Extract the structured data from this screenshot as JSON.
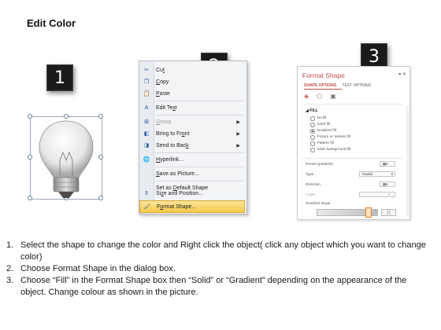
{
  "title": "Edit Color",
  "badges": [
    "1",
    "2",
    "3"
  ],
  "context_menu": {
    "items": [
      {
        "pre": "Cu",
        "u": "t",
        "post": "",
        "icon": "scissors-icon",
        "glyph": "✂"
      },
      {
        "pre": "",
        "u": "C",
        "post": "opy",
        "icon": "copy-icon",
        "glyph": "❐"
      },
      {
        "pre": "",
        "u": "P",
        "post": "aste",
        "icon": "paste-icon",
        "glyph": "📋"
      },
      {
        "pre": "Edit Te",
        "u": "x",
        "post": "t",
        "icon": "edit-text-icon",
        "glyph": "A"
      },
      {
        "pre": "",
        "u": "G",
        "post": "roup",
        "icon": "group-icon",
        "glyph": "⊞",
        "disabled": true,
        "submenu": true
      },
      {
        "pre": "Bring to Fr",
        "u": "o",
        "post": "nt",
        "icon": "bring-to-front-icon",
        "glyph": "◧",
        "submenu": true
      },
      {
        "pre": "Send to Bac",
        "u": "k",
        "post": "",
        "icon": "send-to-back-icon",
        "glyph": "◨",
        "submenu": true
      },
      {
        "pre": "",
        "u": "H",
        "post": "yperlink...",
        "icon": "hyperlink-icon",
        "glyph": "🌐"
      },
      {
        "pre": "",
        "u": "S",
        "post": "ave as Picture...",
        "icon": "",
        "glyph": ""
      },
      {
        "pre": "Set as ",
        "u": "D",
        "post": "efault Shape",
        "icon": "",
        "glyph": ""
      },
      {
        "pre": "Si",
        "u": "z",
        "post": "e and Position...",
        "icon": "size-position-icon",
        "glyph": "⇕"
      },
      {
        "pre": "F",
        "u": "o",
        "post": "rmat Shape...",
        "icon": "format-shape-icon",
        "glyph": "🖌",
        "highlighted": true
      }
    ]
  },
  "format_shape": {
    "title": "Format Shape",
    "tab_active": "SHAPE OPTIONS",
    "tab_other": "TEXT OPTIONS",
    "section": "FILL",
    "options": [
      "No fill",
      "Solid fill",
      "Gradient fill",
      "Picture or texture fill",
      "Pattern fill",
      "Slide background fill"
    ],
    "selected_option": "Gradient fill",
    "preset_label": "Preset gradients",
    "type_label": "Type",
    "type_value": "Radial",
    "direction_label": "Direction",
    "angle_label": "Angle",
    "angle_value": "0°",
    "gradient_stops_label": "Gradient stops"
  },
  "steps": [
    {
      "num": "1.",
      "text": "Select the shape to change the color and Right click the object( click any object which you want to change color)"
    },
    {
      "num": "2.",
      "text": "Choose Format Shape in the dialog box."
    },
    {
      "num": "3.",
      "text": "Choose “Fill” in the Format Shape box then “Solid” or “Gradient” depending on the appearance of the object. Change colour as shown in the picture."
    }
  ]
}
